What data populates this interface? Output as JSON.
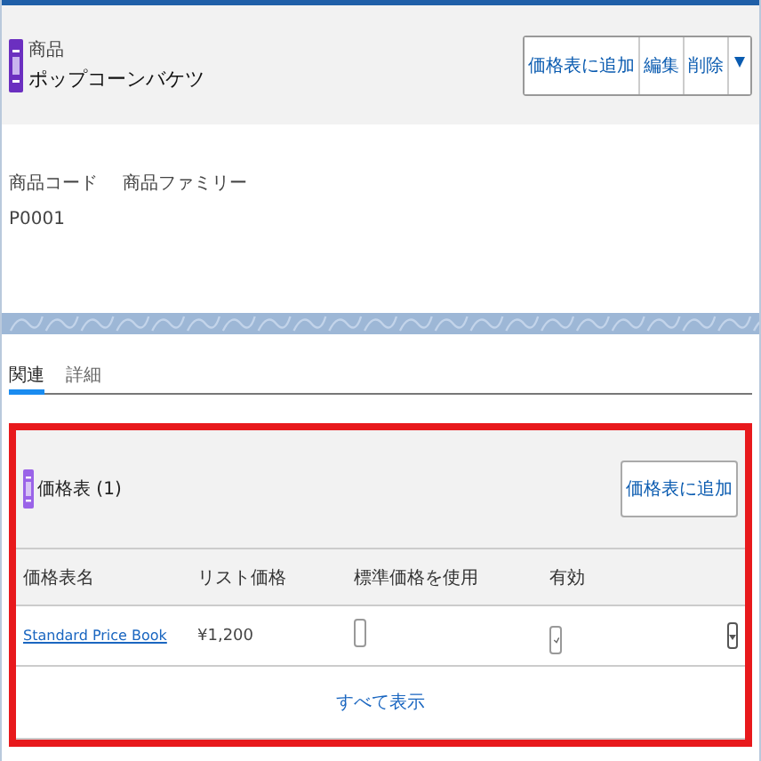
{
  "record": {
    "object_label": "商品",
    "title": "ポップコーンバケツ"
  },
  "actions": [
    {
      "label": "価格表に追加"
    },
    {
      "label": "編集"
    },
    {
      "label": "削除"
    }
  ],
  "fields": [
    {
      "label": "商品コード",
      "value": "P0001"
    },
    {
      "label": "商品ファミリー"
    }
  ],
  "tabs": [
    {
      "label": "関連",
      "selected": true
    },
    {
      "label": "詳細",
      "selected": false
    }
  ],
  "related_list": {
    "title": "価格表 (1)",
    "button": "価格表に追加",
    "columns": [
      "価格表名",
      "リスト価格",
      "標準価格を使用",
      "有効"
    ],
    "rows": [
      {
        "name": "Standard Price Book",
        "price": "¥1,200",
        "use_standard": false,
        "active": true
      }
    ],
    "view_all": "すべて表示"
  }
}
